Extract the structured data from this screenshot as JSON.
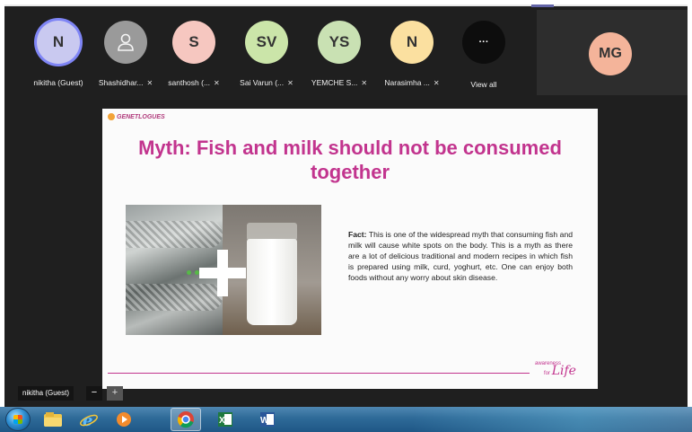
{
  "participants": [
    {
      "initials": "N",
      "name": "nikitha (Guest)",
      "color": "#c9c9f0",
      "muted": false,
      "active": true
    },
    {
      "initials": "",
      "name": "Shashidhar...",
      "color": "#9a9a9a",
      "muted": true,
      "active": false,
      "icon": "person-icon"
    },
    {
      "initials": "S",
      "name": "santhosh (...",
      "color": "#f6c7c0",
      "muted": true,
      "active": false
    },
    {
      "initials": "SV",
      "name": "Sai Varun (...",
      "color": "#cbe5a9",
      "muted": true,
      "active": false
    },
    {
      "initials": "YS",
      "name": "YEMCHE S...",
      "color": "#c9e1b3",
      "muted": true,
      "active": false
    },
    {
      "initials": "N",
      "name": "Narasimha ...",
      "color": "#fbe0a0",
      "muted": true,
      "active": false
    },
    {
      "initials": "···",
      "name": "View all",
      "color": "#0d0d0d",
      "muted": false,
      "active": false
    }
  ],
  "spotlight": {
    "initials": "MG",
    "color": "#f4b49a"
  },
  "slide": {
    "brand": "GENETLOGUES",
    "title": "Myth: Fish and milk should not be consumed together",
    "fact_label": "Fact:",
    "fact_text": "This is one of the widespread myth that consuming fish and milk will cause white spots on the body. This is a myth as there are a lot of delicious traditional and modern recipes in which fish is prepared using milk, curd, yoghurt, etc. One can enjoy both foods without any worry about skin disease.",
    "footer_line1": "awareness",
    "footer_line2": "for",
    "footer_life": "Life",
    "accent_color": "#c2348e"
  },
  "self_view": {
    "name": "nikitha (Guest)",
    "zoom_out": "−",
    "zoom_in": "+"
  },
  "taskbar": {
    "icons": [
      "windows-start-icon",
      "file-explorer-icon",
      "internet-explorer-icon",
      "media-player-icon",
      "chrome-icon",
      "excel-icon",
      "word-icon"
    ]
  }
}
